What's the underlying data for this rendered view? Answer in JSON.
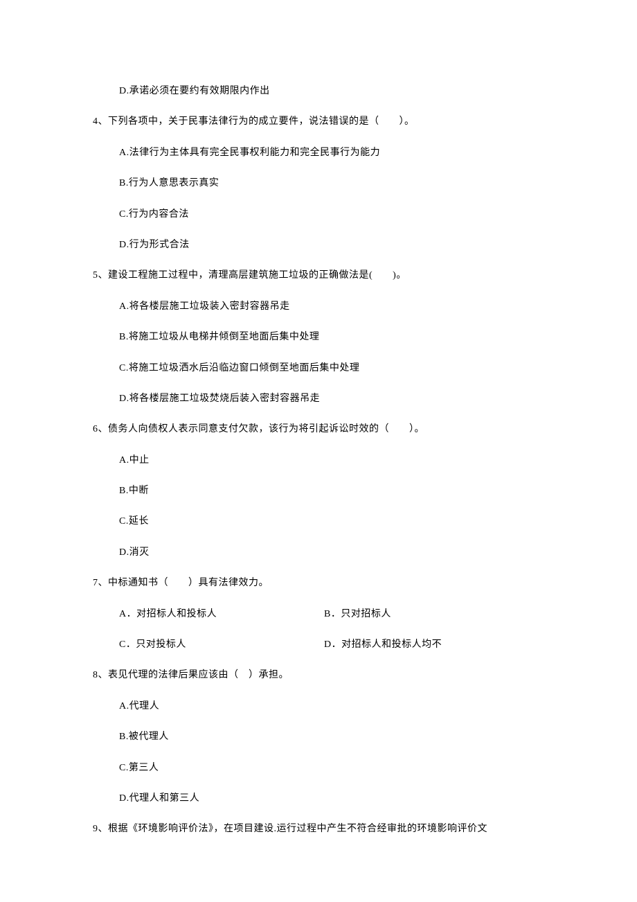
{
  "q3": {
    "optD": "D.承诺必须在要约有效期限内作出"
  },
  "q4": {
    "stem": "4、下列各项中，关于民事法律行为的成立要件，说法错误的是（　　）。",
    "optA": "A.法律行为主体具有完全民事权利能力和完全民事行为能力",
    "optB": "B.行为人意思表示真实",
    "optC": "C.行为内容合法",
    "optD": "D.行为形式合法"
  },
  "q5": {
    "stem": "5、建设工程施工过程中，清理高层建筑施工垃圾的正确做法是(　　)。",
    "optA": "A.将各楼层施工垃圾装入密封容器吊走",
    "optB": "B.将施工垃圾从电梯井倾倒至地面后集中处理",
    "optC": "C.将施工垃圾洒水后沿临边窗口倾倒至地面后集中处理",
    "optD": "D.将各楼层施工垃圾焚烧后装入密封容器吊走"
  },
  "q6": {
    "stem": "6、债务人向债权人表示同意支付欠款，该行为将引起诉讼时效的（　　）。",
    "optA": "A.中止",
    "optB": "B.中断",
    "optC": "C.延长",
    "optD": "D.消灭"
  },
  "q7": {
    "stem": "7、中标通知书（　　）具有法律效力。",
    "optA": "A．对招标人和投标人",
    "optB": "B．只对招标人",
    "optC": "C．只对投标人",
    "optD": "D．对招标人和投标人均不"
  },
  "q8": {
    "stem": "8、表见代理的法律后果应该由（　）承担。",
    "optA": "A.代理人",
    "optB": "B.被代理人",
    "optC": "C.第三人",
    "optD": "D.代理人和第三人"
  },
  "q9": {
    "stem": "9、根据《环境影响评价法》，在项目建设.运行过程中产生不符合经审批的环境影响评价文"
  }
}
